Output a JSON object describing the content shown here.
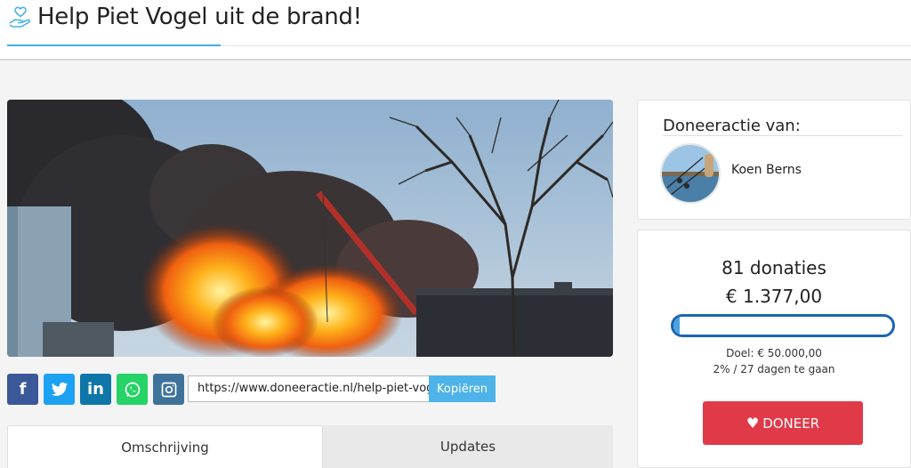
{
  "header": {
    "title": "Help Piet Vogel uit de brand!",
    "logo_icon": "hand-heart-icon",
    "accent": "#43b0e6"
  },
  "share": {
    "buttons": [
      {
        "name": "facebook",
        "glyph": "f",
        "color": "#3b5998"
      },
      {
        "name": "twitter",
        "glyph": "t",
        "color": "#1da1f2"
      },
      {
        "name": "linkedin",
        "glyph": "in",
        "color": "#0e76a8"
      },
      {
        "name": "whatsapp",
        "glyph": "w",
        "color": "#25d366"
      },
      {
        "name": "instagram",
        "glyph": "ig",
        "color": "#3f729b"
      }
    ],
    "url": "https://www.doneeractie.nl/help-piet-vog",
    "copy_label": "Kopiëren"
  },
  "tabs": [
    {
      "label": "Omschrijving",
      "active": true
    },
    {
      "label": "Updates",
      "active": false
    }
  ],
  "organizer": {
    "label": "Doneeractie van:",
    "name": "Koen Berns"
  },
  "stats": {
    "donations": "81 donaties",
    "amount": "€ 1.377,00",
    "progress_fraction": 0.0275,
    "goal": "Doel: € 50.000,00",
    "remaining": "2% / 27 dagen te gaan",
    "progress_color": "#1e64b4"
  },
  "cta": {
    "label": "DONEER",
    "icon": "heart-icon",
    "color": "#e03a49"
  }
}
